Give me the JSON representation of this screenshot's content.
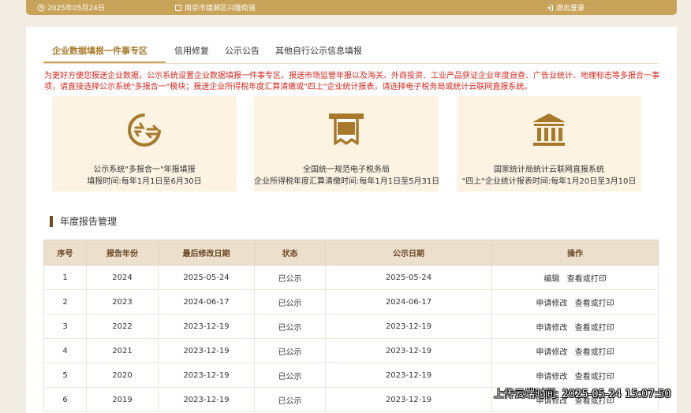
{
  "header": {
    "date_text": "2025年05月24日",
    "org_text": "南京市建邺区兴隆街道",
    "logout_label": "退出登录"
  },
  "tabs": [
    {
      "label": "企业数据填报一件事专区",
      "active": true
    },
    {
      "label": "信用修复",
      "active": false
    },
    {
      "label": "公示公告",
      "active": false
    },
    {
      "label": "其他自行公示信息填报",
      "active": false
    }
  ],
  "notice": "为更好方便您报送企业数据，公示系统设置企业数据填报一件事专区。报送市场监管年报以及海关、外商投资、工业产品获证企业年度自查、广告业统计、地理标志等多报合一事项，请直接选择公示系统\"多报合一\"模块；报送企业所得税年度汇算清缴或\"四上\"企业统计报表，请选择电子税务局或统计云联网直报系统。",
  "systems": [
    {
      "icon": "multi-report-icon",
      "line1": "公示系统\"多报合一\"年报填报",
      "line2": "填报时间:每年1月1日至6月30日"
    },
    {
      "icon": "tax-icon",
      "line1": "全国统一规范电子税务局",
      "line2": "企业所得税年度汇算清缴时间:每年1月1日至5月31日"
    },
    {
      "icon": "bank-building-icon",
      "line1": "国家统计局统计云联网直报系统",
      "line2": "\"四上\"企业统计报表时间:每年1月20日至3月10日"
    }
  ],
  "section_title": "年度报告管理",
  "table": {
    "headers": [
      "序号",
      "报告年份",
      "最后修改日期",
      "状态",
      "公示日期",
      "操作"
    ],
    "rows": [
      {
        "no": "1",
        "year": "2024",
        "modified": "2025-05-24",
        "status": "已公示",
        "published": "2025-05-24",
        "ops": [
          "编辑",
          "查看或打印"
        ]
      },
      {
        "no": "2",
        "year": "2023",
        "modified": "2024-06-17",
        "status": "已公示",
        "published": "2024-06-17",
        "ops": [
          "申请修改",
          "查看或打印"
        ]
      },
      {
        "no": "3",
        "year": "2022",
        "modified": "2023-12-19",
        "status": "已公示",
        "published": "2023-12-19",
        "ops": [
          "申请修改",
          "查看或打印"
        ]
      },
      {
        "no": "4",
        "year": "2021",
        "modified": "2023-12-19",
        "status": "已公示",
        "published": "2023-12-19",
        "ops": [
          "申请修改",
          "查看或打印"
        ]
      },
      {
        "no": "5",
        "year": "2020",
        "modified": "2023-12-19",
        "status": "已公示",
        "published": "2023-12-19",
        "ops": [
          "申请修改",
          "查看或打印"
        ]
      },
      {
        "no": "6",
        "year": "2019",
        "modified": "2023-12-19",
        "status": "已公示",
        "published": "2023-12-19",
        "ops": [
          "申请修改",
          "查看或打印"
        ]
      }
    ]
  },
  "watermark": "上传云端时间: 2025-05-24 15:07:50",
  "colors": {
    "accent": "#c8a45a",
    "notice": "#d9261c",
    "card_bg": "#fcf3e3",
    "header_bg": "#ecdfcc"
  }
}
